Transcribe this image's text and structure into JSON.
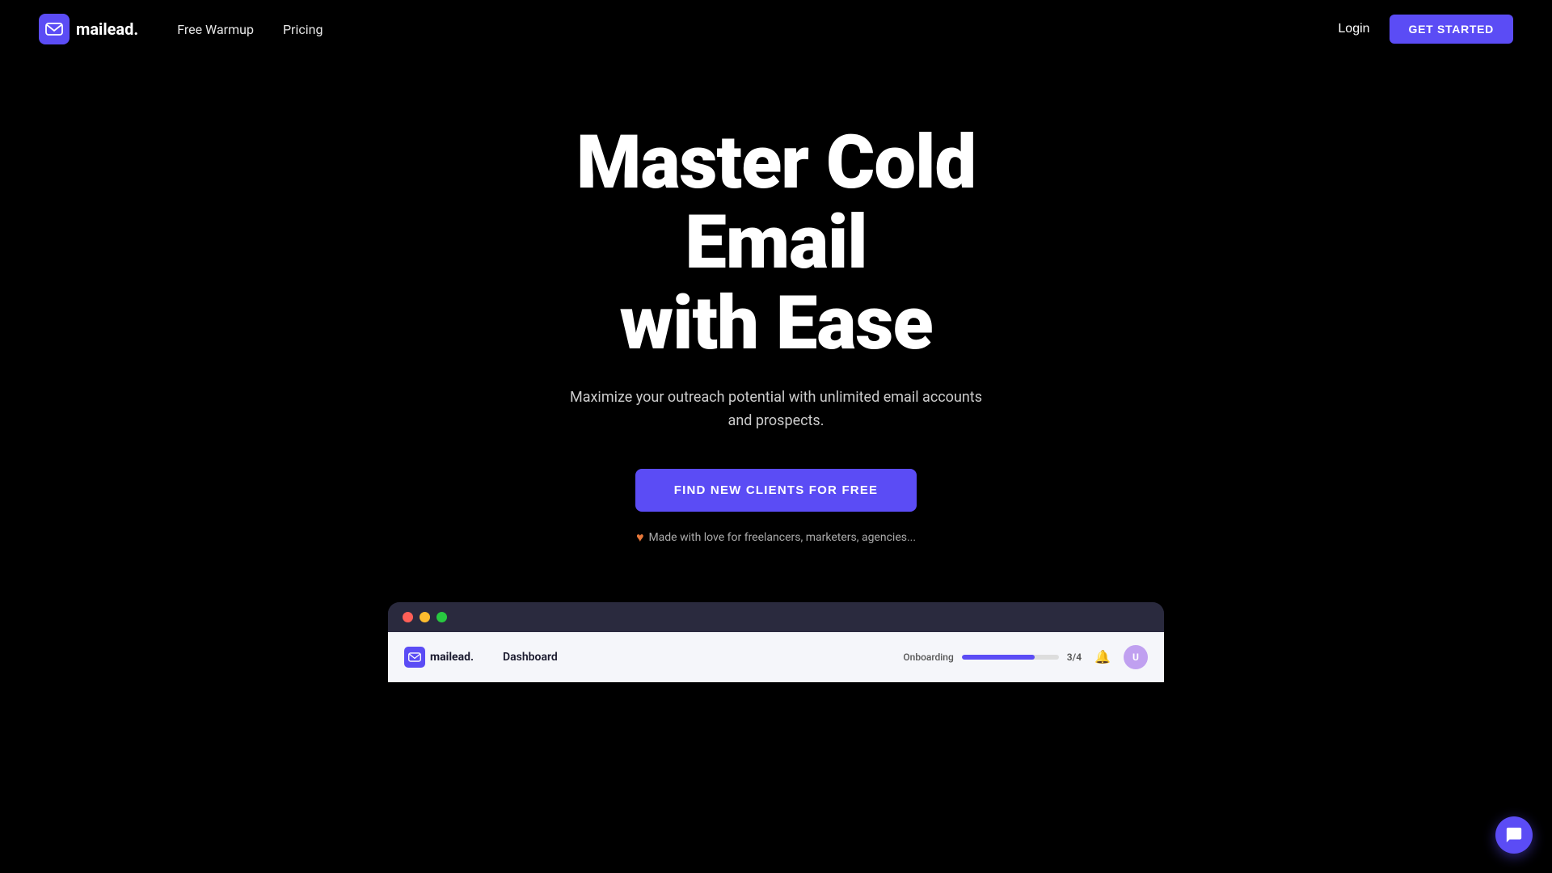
{
  "nav": {
    "logo_text": "mailead.",
    "links": [
      {
        "id": "free-warmup",
        "label": "Free Warmup"
      },
      {
        "id": "pricing",
        "label": "Pricing"
      }
    ],
    "login_label": "Login",
    "get_started_label": "GET STARTED"
  },
  "hero": {
    "title_line1": "Master Cold",
    "title_line2": "Email",
    "title_line3": "with Ease",
    "subtitle": "Maximize your outreach potential with unlimited email accounts and prospects.",
    "cta_label": "FIND NEW CLIENTS FOR FREE",
    "love_text": "Made with love for freelancers, marketers, agencies..."
  },
  "dashboard_preview": {
    "inner_logo_text": "mailead.",
    "dashboard_label": "Dashboard",
    "onboarding_label": "Onboarding",
    "onboarding_count": "3/4",
    "onboarding_progress": 75
  },
  "chat": {
    "icon": "chat-icon"
  }
}
